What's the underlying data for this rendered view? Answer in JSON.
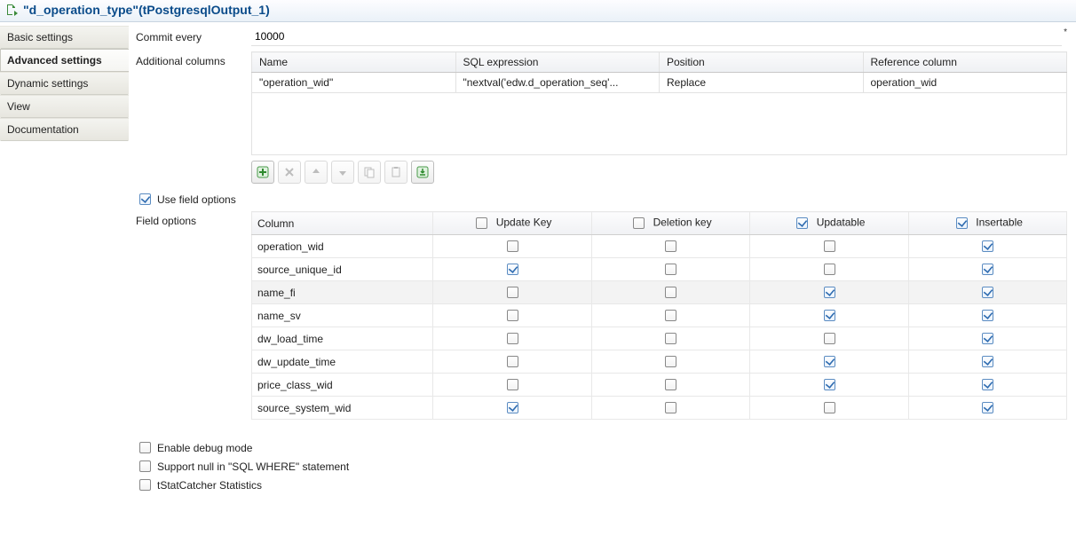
{
  "header": {
    "title": "\"d_operation_type\"(tPostgresqlOutput_1)"
  },
  "sidebar": {
    "tabs": [
      {
        "label": "Basic settings",
        "active": false
      },
      {
        "label": "Advanced settings",
        "active": true
      },
      {
        "label": "Dynamic settings",
        "active": false
      },
      {
        "label": "View",
        "active": false
      },
      {
        "label": "Documentation",
        "active": false
      }
    ]
  },
  "commit": {
    "label": "Commit every",
    "value": "10000"
  },
  "additional_columns": {
    "label": "Additional columns",
    "headers": {
      "name": "Name",
      "sql": "SQL expression",
      "pos": "Position",
      "ref": "Reference column"
    },
    "rows": [
      {
        "name": "\"operation_wid\"",
        "sql": "\"nextval('edw.d_operation_seq'...",
        "pos": "Replace",
        "ref": "operation_wid"
      }
    ]
  },
  "use_field_options": {
    "label": "Use field options",
    "checked": true
  },
  "field_options": {
    "label": "Field options",
    "headers": {
      "col": "Column",
      "upd": "Update Key",
      "del": "Deletion key",
      "updatable": "Updatable",
      "ins": "Insertable"
    },
    "header_checks": {
      "upd": false,
      "del": false,
      "updatable": true,
      "ins": true
    },
    "rows": [
      {
        "column": "operation_wid",
        "upd": false,
        "del": false,
        "updatable": false,
        "ins": true,
        "sel": false
      },
      {
        "column": "source_unique_id",
        "upd": true,
        "del": false,
        "updatable": false,
        "ins": true,
        "sel": false
      },
      {
        "column": "name_fi",
        "upd": false,
        "del": false,
        "updatable": true,
        "ins": true,
        "sel": true
      },
      {
        "column": "name_sv",
        "upd": false,
        "del": false,
        "updatable": true,
        "ins": true,
        "sel": false
      },
      {
        "column": "dw_load_time",
        "upd": false,
        "del": false,
        "updatable": false,
        "ins": true,
        "sel": false
      },
      {
        "column": "dw_update_time",
        "upd": false,
        "del": false,
        "updatable": true,
        "ins": true,
        "sel": false
      },
      {
        "column": "price_class_wid",
        "upd": false,
        "del": false,
        "updatable": true,
        "ins": true,
        "sel": false
      },
      {
        "column": "source_system_wid",
        "upd": true,
        "del": false,
        "updatable": false,
        "ins": true,
        "sel": false
      }
    ]
  },
  "bottom_opts": {
    "debug": {
      "label": "Enable debug mode",
      "checked": false
    },
    "nullsql": {
      "label": "Support null in \"SQL WHERE\" statement",
      "checked": false
    },
    "tstat": {
      "label": "tStatCatcher Statistics",
      "checked": false
    }
  }
}
